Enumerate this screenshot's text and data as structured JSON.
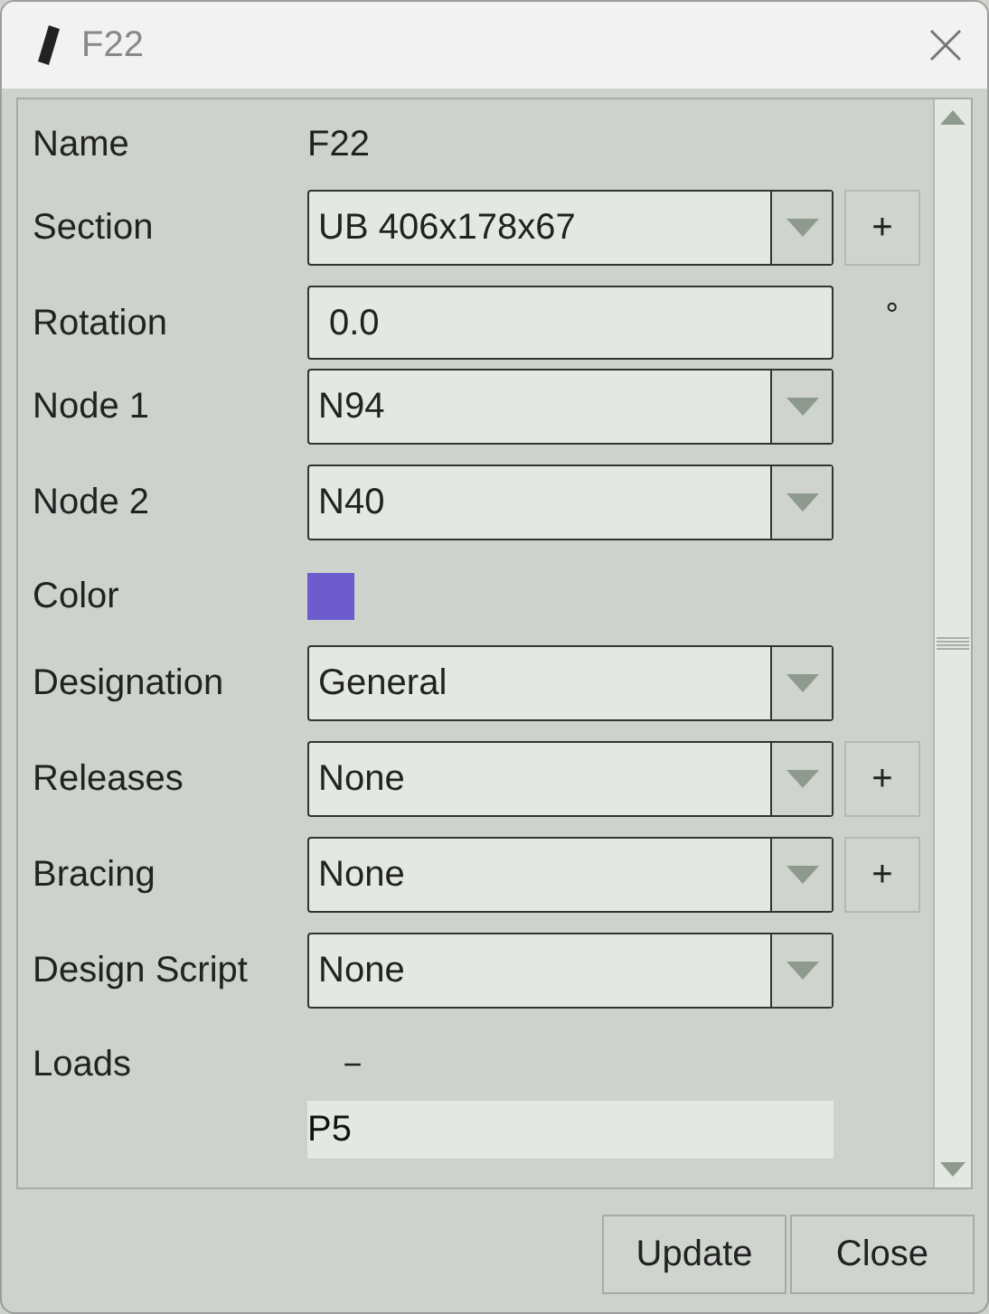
{
  "window": {
    "title": "F22"
  },
  "rows": [
    {
      "kind": "text",
      "label": "Name",
      "value": "F22"
    },
    {
      "kind": "select",
      "label": "Section",
      "value": "UB 406x178x67",
      "add_button": "+"
    },
    {
      "kind": "input",
      "label": "Rotation",
      "value": "0.0",
      "suffix": "°"
    },
    {
      "kind": "select",
      "label": "Node 1",
      "value": "N94"
    },
    {
      "kind": "select",
      "label": "Node 2",
      "value": "N40"
    },
    {
      "kind": "color",
      "label": "Color",
      "color": "#6e5ccf"
    },
    {
      "kind": "select",
      "label": "Designation",
      "value": "General"
    },
    {
      "kind": "select",
      "label": "Releases",
      "value": "None",
      "add_button": "+"
    },
    {
      "kind": "select",
      "label": "Bracing",
      "value": "None",
      "add_button": "+"
    },
    {
      "kind": "select",
      "label": "Design Script",
      "value": "None"
    },
    {
      "kind": "list",
      "label": "Loads",
      "remove_button": "−",
      "items": [
        "P5"
      ]
    }
  ],
  "buttons": [
    "Update",
    "Close"
  ]
}
